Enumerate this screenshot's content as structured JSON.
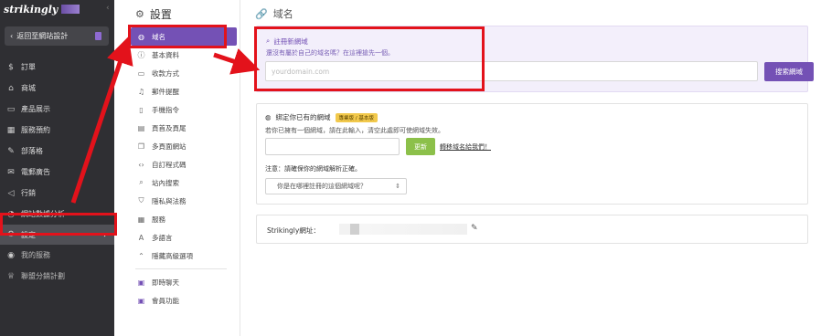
{
  "sidebar": {
    "logo_text": "strikingly",
    "back_label": "返回至網站設計",
    "items": [
      {
        "label": "訂單",
        "icon": "dollar-icon"
      },
      {
        "label": "商城",
        "icon": "store-icon"
      },
      {
        "label": "產品展示",
        "icon": "showcase-icon"
      },
      {
        "label": "服務預約",
        "icon": "calendar-icon"
      },
      {
        "label": "部落格",
        "icon": "pen-icon"
      },
      {
        "label": "電郵廣告",
        "icon": "mail-icon"
      },
      {
        "label": "行銷",
        "icon": "megaphone-icon"
      },
      {
        "label": "網站數據分析",
        "icon": "chart-icon"
      },
      {
        "label": "設定",
        "icon": "gear-icon",
        "active": true
      },
      {
        "label": "我的服務",
        "icon": "service-icon"
      },
      {
        "label": "聯盟分銷計劃",
        "icon": "trophy-icon"
      }
    ]
  },
  "settings": {
    "title": "設置",
    "items": [
      {
        "label": "域名",
        "icon": "globe-icon",
        "active": true
      },
      {
        "label": "基本資料",
        "icon": "info-icon"
      },
      {
        "label": "收款方式",
        "icon": "payment-icon"
      },
      {
        "label": "郵件提醒",
        "icon": "bell-icon"
      },
      {
        "label": "手機指令",
        "icon": "phone-icon"
      },
      {
        "label": "頁首及頁尾",
        "icon": "layout-icon"
      },
      {
        "label": "多頁面網站",
        "icon": "pages-icon"
      },
      {
        "label": "自訂程式碼",
        "icon": "code-icon"
      },
      {
        "label": "站內搜索",
        "icon": "search-icon"
      },
      {
        "label": "隱私與法務",
        "icon": "shield-icon"
      },
      {
        "label": "服務",
        "icon": "grid-icon"
      },
      {
        "label": "多語言",
        "icon": "language-icon"
      },
      {
        "label": "隱藏高級選項",
        "icon": "chevron-up-icon"
      }
    ],
    "extra_items": [
      {
        "label": "即時聊天",
        "icon": "chat-icon"
      },
      {
        "label": "會員功能",
        "icon": "member-icon"
      }
    ]
  },
  "main": {
    "title": "域名",
    "register": {
      "heading": "註冊新網域",
      "subtitle": "還沒有屬於自己的域名嗎？在這裡搶先一個。",
      "placeholder": "yourdomain.com",
      "value": "",
      "button": "搜索網域"
    },
    "bind": {
      "heading": "綁定你已有的網域",
      "badge": "專業版 / 基本版",
      "subtitle": "若你已擁有一個網域，請在此輸入，清空此處即可使網域失效。",
      "value": "",
      "button": "更新",
      "transfer_link": "轉移域名給我們！",
      "notice": "注意：請確保你的網域解析正確。",
      "select_value": "你是在哪裡註冊的這個網域呢？"
    },
    "url": {
      "label": "Strikingly網址："
    }
  },
  "colors": {
    "brand_purple": "#7451b5",
    "update_green": "#8cc04a",
    "annotation_red": "#e3121b",
    "sidebar_bg": "#2f2f33"
  }
}
